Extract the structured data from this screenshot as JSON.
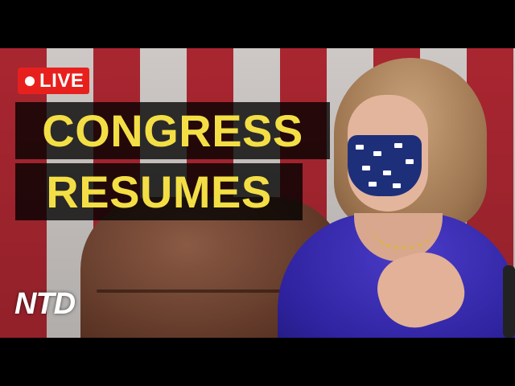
{
  "live_badge": {
    "label": "LIVE",
    "color": "#e8201d"
  },
  "headline": {
    "line1": "CONGRESS",
    "line2": "RESUMES",
    "color": "#f3df45"
  },
  "logo": {
    "text": "NTD"
  },
  "colors": {
    "flag_red": "#b22833",
    "flag_white": "#d8d3d0",
    "jacket": "#2f23a0",
    "letterbox": "#000000"
  }
}
